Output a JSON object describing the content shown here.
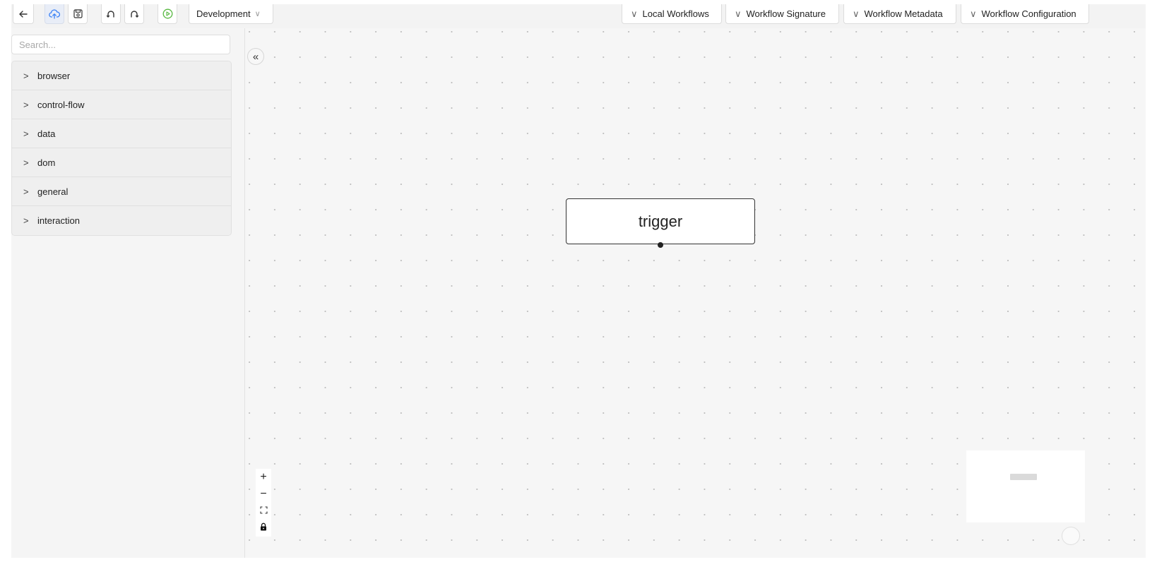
{
  "toolbar": {
    "buttons": {
      "back": "back-arrow-icon",
      "upload": "cloud-upload-icon",
      "save": "save-icon",
      "undo": "undo-icon",
      "redo": "redo-icon",
      "run": "play-circle-icon"
    },
    "environment": "Development",
    "panels": [
      "Local Workflows",
      "Workflow Signature",
      "Workflow Metadata",
      "Workflow Configuration"
    ]
  },
  "sidebar": {
    "search_placeholder": "Search...",
    "categories": [
      "browser",
      "control-flow",
      "data",
      "dom",
      "general",
      "interaction"
    ]
  },
  "canvas": {
    "collapse_symbol": "«",
    "node_label": "trigger",
    "zoom_controls": {
      "zoom_in": "+",
      "zoom_out": "−"
    }
  },
  "colors": {
    "accent": "#3b82f6",
    "run_green": "#57b840",
    "canvas_bg": "#f6f6f6"
  }
}
